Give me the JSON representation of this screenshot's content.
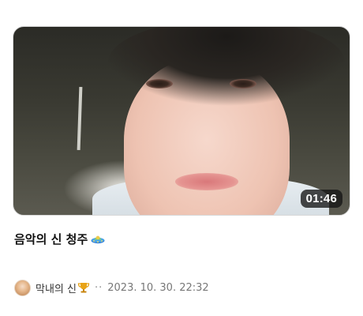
{
  "video": {
    "duration": "01:46"
  },
  "post": {
    "title": "음악의 신 청주",
    "title_icon": "ufo-icon"
  },
  "meta": {
    "author": "막내의 신",
    "author_badge_icon": "trophy-icon",
    "separator": "··",
    "date": "2023. 10. 30. 22:32"
  },
  "colors": {
    "duration_bg": "#141414",
    "meta_text": "#777777",
    "trophy": "#e8a317"
  }
}
